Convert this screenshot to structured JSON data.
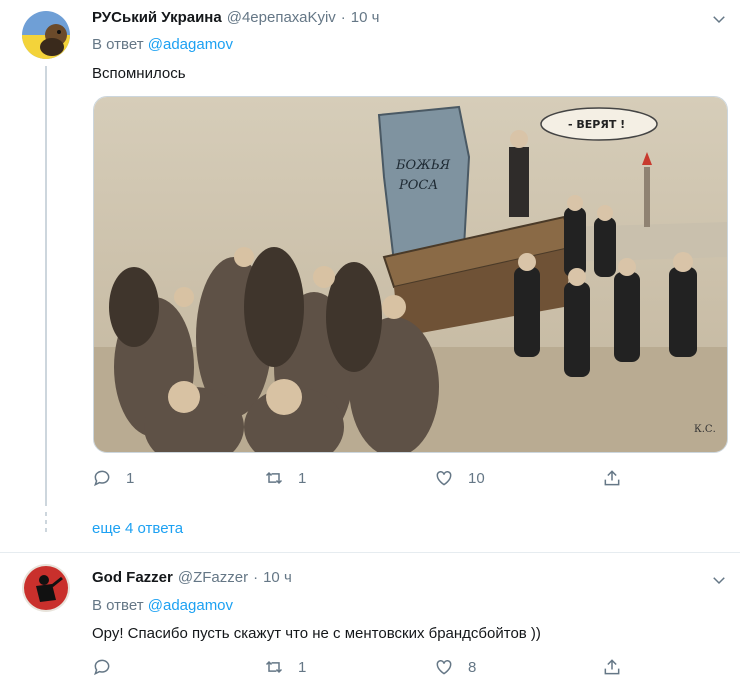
{
  "tweets": [
    {
      "name": "РУСький Украина",
      "handle": "@4ерепахаKyiv",
      "separator": "·",
      "time": "10 ч",
      "reply_prefix": "В ответ",
      "reply_to": "@adagamov",
      "text": "Вспомнилось",
      "media_caption_tablet": "БОЖЬЯ\nРОСА",
      "media_caption_bubble": "- ВЕРЯТ !",
      "media_signature": "К.С.",
      "actions": {
        "reply": "1",
        "retweet": "1",
        "like": "10"
      }
    },
    {
      "name": "God Fazzer",
      "handle": "@ZFazzer",
      "separator": "·",
      "time": "10 ч",
      "reply_prefix": "В ответ",
      "reply_to": "@adagamov",
      "text": "Ору! Спасибо пусть скажут что не с ментовских брандсбойтов ))",
      "actions": {
        "reply": "",
        "retweet": "1",
        "like": "8"
      }
    }
  ],
  "more_replies": "еще 4 ответа",
  "colors": {
    "accent": "#1da1f2",
    "muted": "#657786",
    "text": "#14171a",
    "divider": "#e6ecf0"
  },
  "icons": [
    "reply-icon",
    "retweet-icon",
    "like-icon",
    "share-icon",
    "chevron-down-icon"
  ]
}
